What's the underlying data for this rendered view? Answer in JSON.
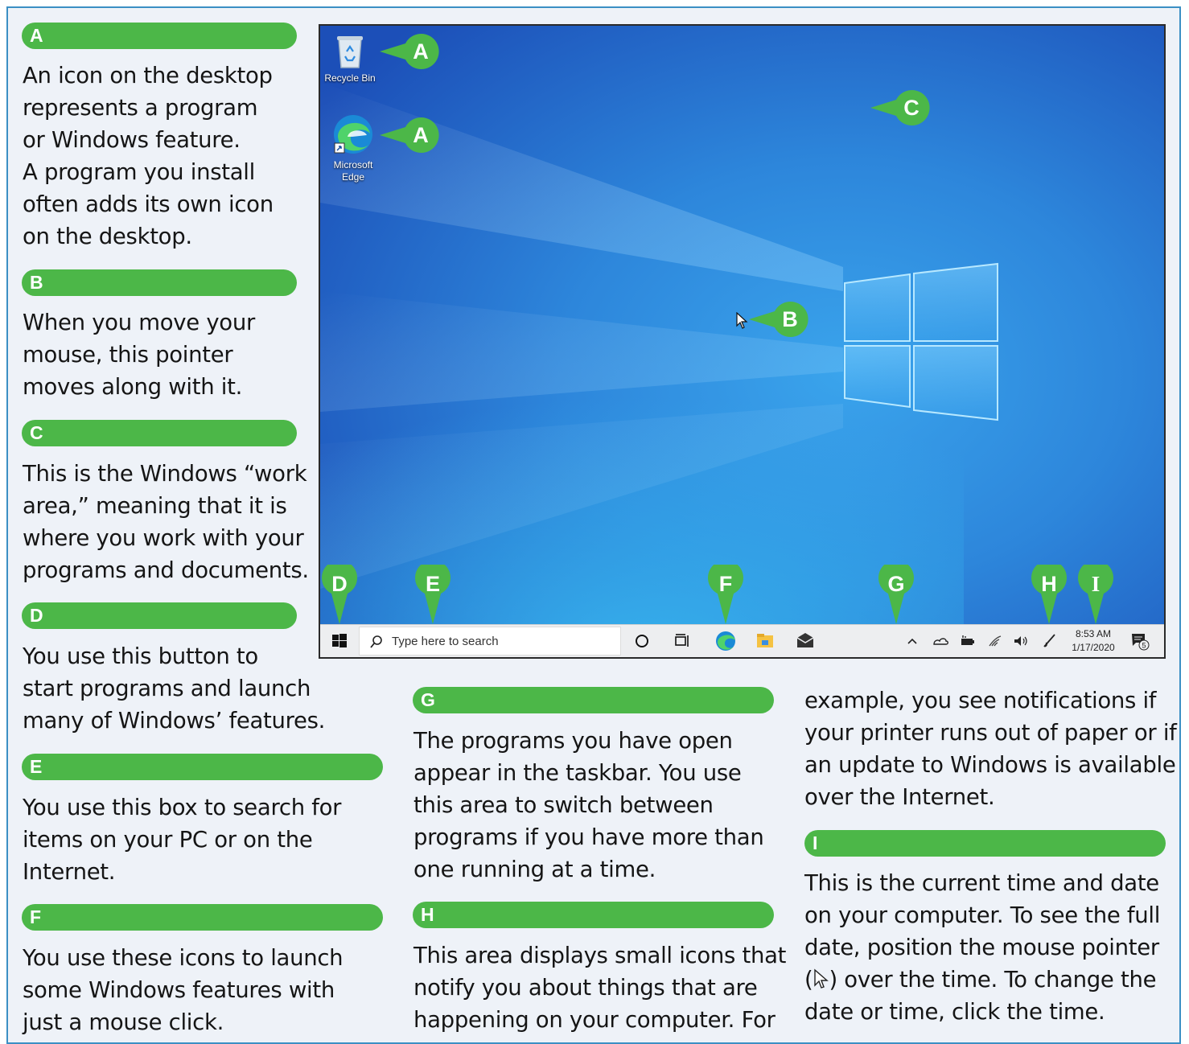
{
  "legend": [
    {
      "letter": "A",
      "lines": [
        "An icon on the desktop",
        "represents a program",
        "or Windows feature.",
        "A program you install",
        "often adds its own icon",
        "on the desktop."
      ]
    },
    {
      "letter": "B",
      "lines": [
        "When you move your",
        "mouse, this pointer",
        "moves along with it."
      ]
    },
    {
      "letter": "C",
      "lines": [
        "This is the Windows “work",
        "area,” meaning that it is",
        "where you work with your",
        "programs and documents."
      ]
    },
    {
      "letter": "D",
      "lines": [
        "You use this button to",
        "start programs and launch",
        "many of Windows’ features."
      ]
    },
    {
      "letter": "E",
      "lines": [
        "You use this box to search for",
        "items on your PC or on the",
        "Internet."
      ]
    },
    {
      "letter": "F",
      "lines": [
        "You use these icons to launch",
        "some Windows features with",
        "just a mouse click."
      ]
    },
    {
      "letter": "G",
      "lines": [
        "The programs you have open",
        "appear in the taskbar. You use",
        "this area to switch between",
        "programs if you have more than",
        "one running at a time."
      ]
    },
    {
      "letter": "H",
      "lines": [
        "This area displays small icons that",
        "notify you about things that are",
        "happening on your computer. For",
        "example, you see notifications if",
        "your printer runs out of paper or if",
        "an update to Windows is available",
        "over the Internet."
      ]
    },
    {
      "letter": "I",
      "lines": [
        "This is the current time and date",
        "on your computer. To see the full",
        "date, position the mouse pointer",
        "(",
        ") over the time. To change the",
        "date or time, click the time."
      ]
    }
  ],
  "desktop": {
    "icons": [
      {
        "label": "Recycle Bin",
        "icon": "recycle-bin-icon"
      },
      {
        "label_line1": "Microsoft",
        "label_line2": "Edge",
        "icon": "edge-icon"
      }
    ]
  },
  "taskbar": {
    "search_placeholder": "Type here to search",
    "time": "8:53 AM",
    "date": "1/17/2020",
    "notification_count": "5"
  },
  "callouts": [
    "A",
    "A",
    "C",
    "B",
    "D",
    "E",
    "F",
    "G",
    "H",
    "I"
  ],
  "colors": {
    "accent_green": "#4cb748",
    "frame_blue": "#3b8fc4",
    "desktop_blue": "#2161c9"
  }
}
